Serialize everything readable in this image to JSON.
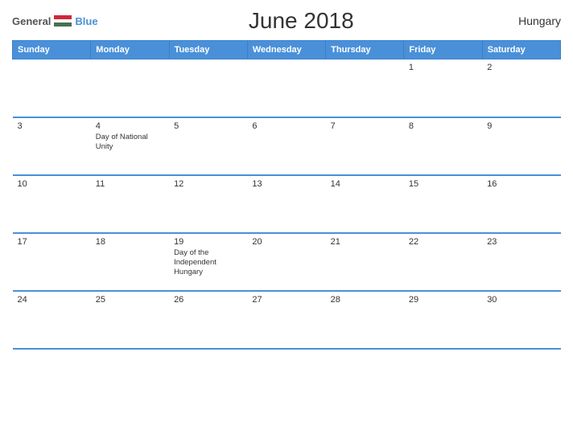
{
  "header": {
    "logo_general": "General",
    "logo_blue": "Blue",
    "title": "June 2018",
    "country": "Hungary"
  },
  "weekdays": [
    "Sunday",
    "Monday",
    "Tuesday",
    "Wednesday",
    "Thursday",
    "Friday",
    "Saturday"
  ],
  "weeks": [
    [
      {
        "day": "",
        "event": ""
      },
      {
        "day": "",
        "event": ""
      },
      {
        "day": "",
        "event": ""
      },
      {
        "day": "",
        "event": ""
      },
      {
        "day": "",
        "event": ""
      },
      {
        "day": "1",
        "event": ""
      },
      {
        "day": "2",
        "event": ""
      }
    ],
    [
      {
        "day": "3",
        "event": ""
      },
      {
        "day": "4",
        "event": "Day of National Unity"
      },
      {
        "day": "5",
        "event": ""
      },
      {
        "day": "6",
        "event": ""
      },
      {
        "day": "7",
        "event": ""
      },
      {
        "day": "8",
        "event": ""
      },
      {
        "day": "9",
        "event": ""
      }
    ],
    [
      {
        "day": "10",
        "event": ""
      },
      {
        "day": "11",
        "event": ""
      },
      {
        "day": "12",
        "event": ""
      },
      {
        "day": "13",
        "event": ""
      },
      {
        "day": "14",
        "event": ""
      },
      {
        "day": "15",
        "event": ""
      },
      {
        "day": "16",
        "event": ""
      }
    ],
    [
      {
        "day": "17",
        "event": ""
      },
      {
        "day": "18",
        "event": ""
      },
      {
        "day": "19",
        "event": "Day of the Independent Hungary"
      },
      {
        "day": "20",
        "event": ""
      },
      {
        "day": "21",
        "event": ""
      },
      {
        "day": "22",
        "event": ""
      },
      {
        "day": "23",
        "event": ""
      }
    ],
    [
      {
        "day": "24",
        "event": ""
      },
      {
        "day": "25",
        "event": ""
      },
      {
        "day": "26",
        "event": ""
      },
      {
        "day": "27",
        "event": ""
      },
      {
        "day": "28",
        "event": ""
      },
      {
        "day": "29",
        "event": ""
      },
      {
        "day": "30",
        "event": ""
      }
    ]
  ]
}
